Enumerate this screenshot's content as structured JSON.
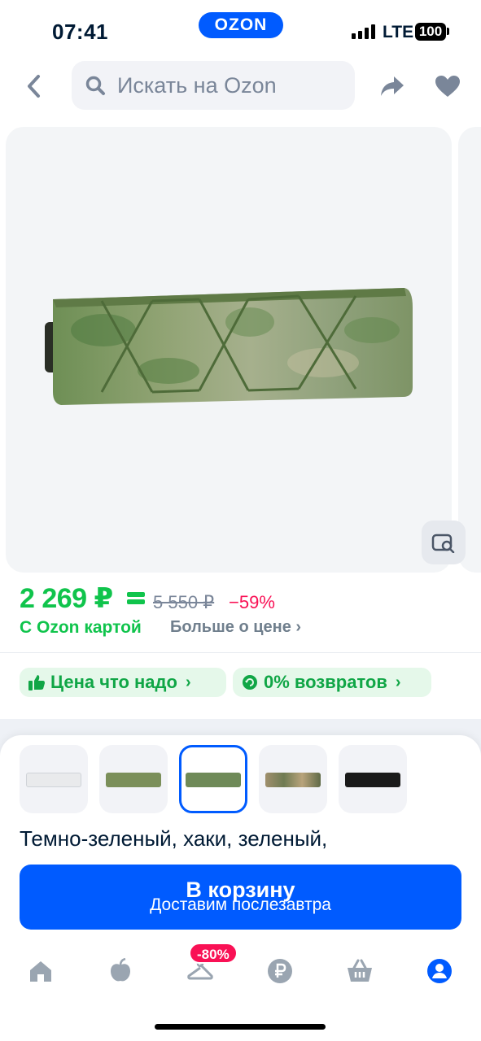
{
  "status": {
    "time": "07:41",
    "brand": "OZON",
    "network": "LTE",
    "battery": "100"
  },
  "header": {
    "search_placeholder": "Искать на Ozon"
  },
  "price": {
    "current": "2 269 ₽",
    "old": "5 550 ₽",
    "discount": "−59%",
    "card_label": "С Ozon картой",
    "more_label": "Больше о цене ›"
  },
  "badges": [
    {
      "label": "Цена что надо"
    },
    {
      "label": "0% возвратов"
    }
  ],
  "variants": [
    {
      "color": "#e9eaec"
    },
    {
      "color": "#7b8f5a"
    },
    {
      "color": "#6f8a58"
    },
    {
      "color": "#a08f6d"
    },
    {
      "color": "#1a1a1a"
    }
  ],
  "product": {
    "colors_line": "Темно-зеленый, хаки, зеленый,"
  },
  "cart": {
    "title": "В корзину",
    "subtitle": "Доставим послезавтра"
  },
  "nav": {
    "promo": "-80%"
  },
  "colors": {
    "accent": "#005bff",
    "green": "#10c44c",
    "red": "#f91155"
  }
}
